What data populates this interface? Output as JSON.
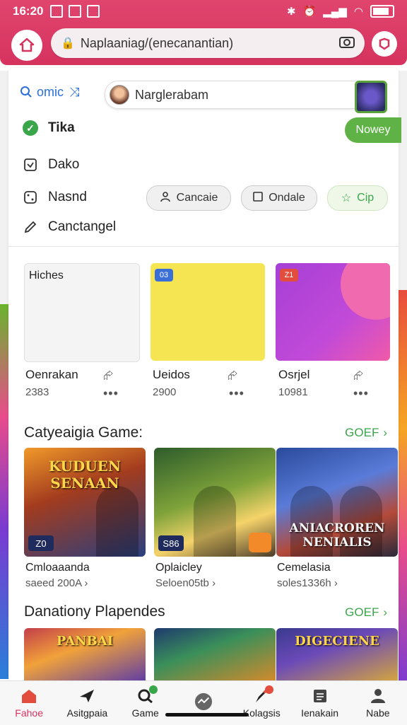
{
  "status": {
    "time": "16:20"
  },
  "header": {
    "url": "Naplaaniag/(enecanantian)"
  },
  "search": {
    "label": "omic",
    "value": "Narglerabam"
  },
  "menu": [
    {
      "label": "Tika",
      "badge": "Nowey"
    },
    {
      "label": "Dako"
    },
    {
      "label": "Nasnd"
    },
    {
      "label": "Canctangel"
    }
  ],
  "pills": [
    "Cancaie",
    "Ondale",
    "Cip"
  ],
  "tiles": [
    {
      "label": "Hiches",
      "title": "Oenrakan",
      "sub": "2383"
    },
    {
      "tag": "03",
      "title": "Ueidos",
      "sub": "2900"
    },
    {
      "tag": "Z1",
      "title": "Osrjel",
      "sub": "10981"
    }
  ],
  "section1": {
    "title": "Catyeaigia Game:",
    "see_all": "GOEF",
    "games": [
      {
        "art": "KUDUEN SENAAN",
        "badge": "Z0",
        "name": "Cmloaaanda",
        "meta": "saeed 200A ›"
      },
      {
        "art": "",
        "badge": "S86",
        "name": "Oplaicley",
        "meta": "Seloen05tb ›"
      },
      {
        "art": "ANIACROREN NENIALIS",
        "badge": "",
        "name": "Cemelasia",
        "meta": "soles1336h ›"
      }
    ]
  },
  "section2": {
    "title": "Danationy Plapendes",
    "see_all": "GOEF",
    "games": [
      {
        "art": "PANBAI"
      },
      {
        "art": ""
      },
      {
        "art": "DIGECIENE"
      }
    ]
  },
  "nav": [
    {
      "label": "Fahoe",
      "icon": "home-icon",
      "active": true
    },
    {
      "label": "Asitgpaia",
      "icon": "paper-plane-icon"
    },
    {
      "label": "Game",
      "icon": "game-search-icon"
    },
    {
      "label": "",
      "icon": "activity-icon"
    },
    {
      "label": "Kolagsis",
      "icon": "rocket-icon"
    },
    {
      "label": "Ienakain",
      "icon": "document-icon"
    },
    {
      "label": "Nabe",
      "icon": "profile-icon"
    }
  ],
  "colors": {
    "brand": "#d6335f",
    "accent_green": "#3aa64a",
    "link_blue": "#2a6fd8"
  }
}
